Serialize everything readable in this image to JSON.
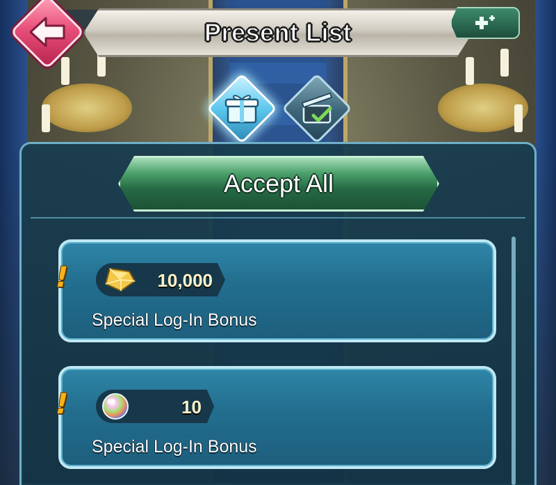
{
  "header": {
    "title": "Present List",
    "back_icon": "back-arrow-icon",
    "menu_icon": "dpad-plus-icon"
  },
  "tabs": [
    {
      "id": "gifts",
      "icon": "gift-box-icon",
      "active": true
    },
    {
      "id": "history",
      "icon": "opened-box-check-icon",
      "active": false
    }
  ],
  "accept_all": {
    "label": "Accept All"
  },
  "presents": [
    {
      "alert": "!",
      "reward_icon": "orb-crystal-gold-icon",
      "amount": "10,000",
      "description": "Special Log-In Bonus"
    },
    {
      "alert": "!",
      "reward_icon": "orb-rainbow-icon",
      "amount": "10",
      "description": "Special Log-In Bonus"
    }
  ],
  "colors": {
    "back_button": "#e8507a",
    "accept_button": "#256a44",
    "card": "#236f90",
    "panel": "#183c4e",
    "alert": "#f6b21a",
    "amount_text": "#fdf3c8"
  }
}
